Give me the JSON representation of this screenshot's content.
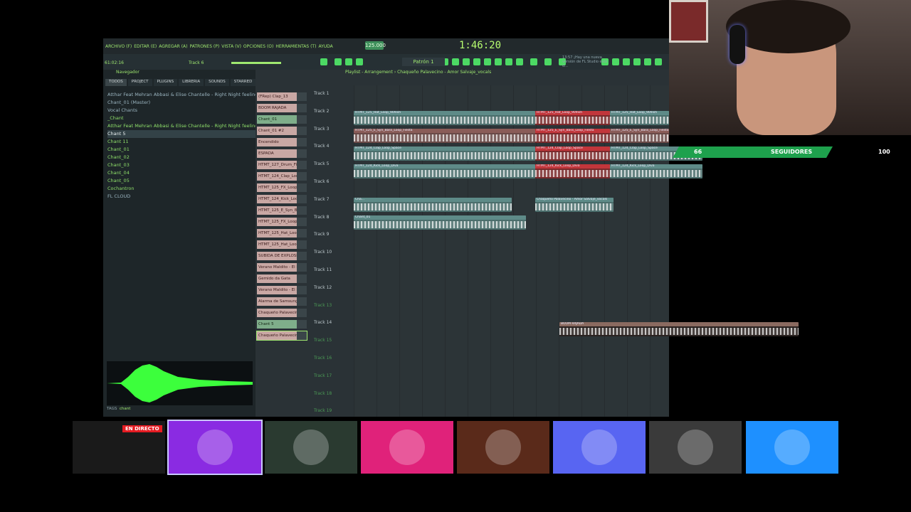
{
  "fl": {
    "menu": [
      "ARCHIVO (F)",
      "EDITAR (E)",
      "AGREGAR (A)",
      "PATRONES (P)",
      "VISTA (V)",
      "OPCIONES (O)",
      "HERRAMIENTAS (T)",
      "AYUDA"
    ],
    "tempo": "125.000",
    "timer": "1:46:20",
    "pattern": "Patrón 1",
    "hint": "13:57 ¡Hay una nueva versión de FL Studio está d...",
    "song_pos": "61:02:16",
    "track_label": "Track 6",
    "playlist_title": "Playlist - Arrangement › Chaqueño Palavecino - Amor Salvaje_vocals"
  },
  "browser": {
    "header": "Navegador",
    "tabs": [
      "TODOS",
      "PROJECT",
      "PLUGINS",
      "LIBRERIA",
      "SOUNDS",
      "STARRED"
    ],
    "items": [
      {
        "label": "Atthar Feat Mehran Abbasi & Elise Chantelle - Right Night feeling",
        "cls": ""
      },
      {
        "label": "Chant_01 (Master)",
        "cls": ""
      },
      {
        "label": "Vocal Chants",
        "cls": ""
      },
      {
        "label": "_Chant",
        "cls": "green"
      },
      {
        "label": "Atthar Feat Mehran Abbasi & Elise Chantelle - Right Night feeling",
        "cls": "green"
      },
      {
        "label": "Chant 5",
        "cls": "sel"
      },
      {
        "label": "Chant 11",
        "cls": "green"
      },
      {
        "label": "Chant_01",
        "cls": "green"
      },
      {
        "label": "Chant_02",
        "cls": "green"
      },
      {
        "label": "Chant_03",
        "cls": "green"
      },
      {
        "label": "Chant_04",
        "cls": "green"
      },
      {
        "label": "Chant_05",
        "cls": "green"
      },
      {
        "label": "Cochantron",
        "cls": "green"
      },
      {
        "label": "FL CLOUD",
        "cls": ""
      }
    ],
    "tags_label": "TAGS",
    "tag": "chant"
  },
  "channels": [
    {
      "label": "(FRep) Clap_13",
      "cls": ""
    },
    {
      "label": "BOOM RAJADA",
      "cls": ""
    },
    {
      "label": "Chant_01",
      "cls": "green"
    },
    {
      "label": "Chant_01 #2",
      "cls": ""
    },
    {
      "label": "Encendido",
      "cls": ""
    },
    {
      "label": "ESPADA",
      "cls": ""
    },
    {
      "label": "HTMT_127_Drum_Fill_",
      "cls": ""
    },
    {
      "label": "HTMT_124_Clap_Loo_",
      "cls": ""
    },
    {
      "label": "HTMT_125_FX_Loop_",
      "cls": ""
    },
    {
      "label": "HTMT_124_Kick_Loo_",
      "cls": ""
    },
    {
      "label": "HTMT_125_E_Syn_Ba_",
      "cls": ""
    },
    {
      "label": "HTMT_125_FX_Loop_",
      "cls": ""
    },
    {
      "label": "HTMT_125_Hat_Loop_",
      "cls": ""
    },
    {
      "label": "HTMT_125_Hat_Loop_",
      "cls": ""
    },
    {
      "label": "SUBIDA DE EXPLOSIO_",
      "cls": ""
    },
    {
      "label": "Verano Maldito - El R_",
      "cls": ""
    },
    {
      "label": "Gemido da Gata",
      "cls": ""
    },
    {
      "label": "Verano Maldito - El R_",
      "cls": ""
    },
    {
      "label": "Alarma de Samsung_",
      "cls": ""
    },
    {
      "label": "Chaqueño Palavecino_",
      "cls": ""
    },
    {
      "label": "Chant 5",
      "cls": "green"
    },
    {
      "label": "Chaqueño Palavecino_",
      "cls": "sel"
    }
  ],
  "tracks": [
    {
      "label": "Track 1",
      "cls": ""
    },
    {
      "label": "Track 2",
      "cls": ""
    },
    {
      "label": "Track 3",
      "cls": ""
    },
    {
      "label": "Track 4",
      "cls": ""
    },
    {
      "label": "Track 5",
      "cls": ""
    },
    {
      "label": "Track 6",
      "cls": ""
    },
    {
      "label": "Track 7",
      "cls": ""
    },
    {
      "label": "Track 8",
      "cls": ""
    },
    {
      "label": "Track 9",
      "cls": ""
    },
    {
      "label": "Track 10",
      "cls": ""
    },
    {
      "label": "Track 11",
      "cls": ""
    },
    {
      "label": "Track 12",
      "cls": ""
    },
    {
      "label": "Track 13",
      "cls": "dim"
    },
    {
      "label": "Track 14",
      "cls": ""
    },
    {
      "label": "Track 15",
      "cls": "dim"
    },
    {
      "label": "Track 16",
      "cls": "dim"
    },
    {
      "label": "Track 17",
      "cls": "dim"
    },
    {
      "label": "Track 18",
      "cls": "dim"
    },
    {
      "label": "Track 19",
      "cls": "dim"
    }
  ],
  "clips": [
    {
      "label": "HTMT_125_Hat_Loop_909ish",
      "color": "teal"
    },
    {
      "label": "HTMT_125_Hat_Loop_909ish",
      "color": "red"
    },
    {
      "label": "HTMT_125_Hat_Loop_909ish",
      "color": "teal"
    },
    {
      "label": "HTMT_125_E_Syn_Bass_Loop_Fiesta",
      "color": "pink"
    },
    {
      "label": "HTMT_125_E_Syn_Bass_Loop_Fiesta",
      "color": "red"
    },
    {
      "label": "HTMT_125_E_Syn_Bass_Loop_Fiesta",
      "color": "pink"
    },
    {
      "label": "HTMT_124_Clap_Loop_Space",
      "color": "teal"
    },
    {
      "label": "HTMT_124_Clap_Loop_Space",
      "color": "red"
    },
    {
      "label": "HTMT_124_Clap_Loop_Space",
      "color": "teal"
    },
    {
      "label": "HTMT_124_Kick_Loop_Diva",
      "color": "teal"
    },
    {
      "label": "HTMT_124_Kick_Loop_Diva",
      "color": "red"
    },
    {
      "label": "HTMT_124_Kick_Loop_Diva",
      "color": "teal"
    },
    {
      "label": "Cha...",
      "color": "teal"
    },
    {
      "label": "Chaqueño Palavecino - Amor Salvaje_vocals",
      "color": "teal"
    },
    {
      "label": "Chant_01",
      "color": "teal"
    },
    {
      "label": "BOOM RAJADA",
      "color": "brown"
    }
  ],
  "overlay": {
    "followers": "66",
    "followers_label": "SEGUIDORES",
    "followers_goal": "100",
    "live_badge": "EN DIRECTO"
  },
  "tiles": [
    {
      "name": "obs-tile",
      "color": "#1a1a1a"
    },
    {
      "name": "minecraft-tile",
      "color": "#8a2be2"
    },
    {
      "name": "streamer-tile",
      "color": "#2a3a30"
    },
    {
      "name": "spiderverse-tile",
      "color": "#e0227a"
    },
    {
      "name": "flame-tile",
      "color": "#5a2a1a"
    },
    {
      "name": "discord-tile",
      "color": "#5865f2"
    },
    {
      "name": "anime-tile",
      "color": "#3a3a3a"
    },
    {
      "name": "beatsaber-tile",
      "color": "#1e90ff"
    }
  ]
}
